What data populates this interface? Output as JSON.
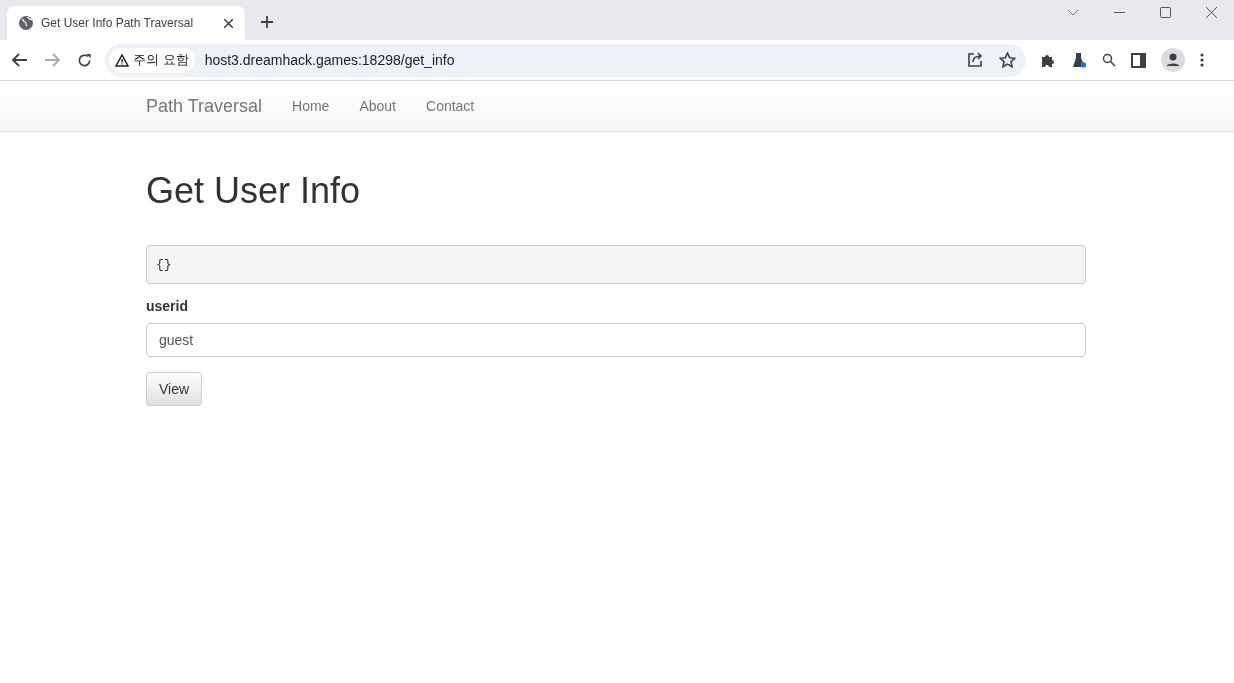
{
  "browser": {
    "tabs": [
      {
        "title": "Get User Info Path Traversal",
        "selected": true
      }
    ],
    "security_chip": "주의 요함",
    "url": "host3.dreamhack.games:18298/get_info"
  },
  "navbar": {
    "brand": "Path Traversal",
    "links": [
      "Home",
      "About",
      "Contact"
    ]
  },
  "page": {
    "heading": "Get User Info",
    "result": "{}",
    "field_label": "userid",
    "field_value": "guest",
    "button": "View"
  }
}
